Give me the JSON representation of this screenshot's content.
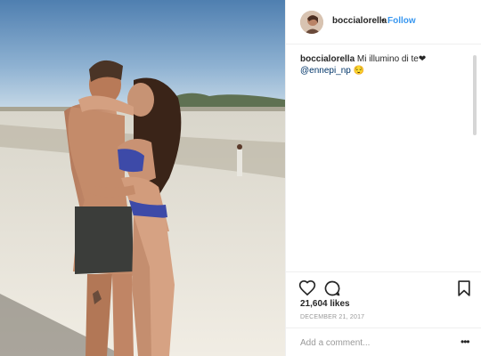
{
  "post": {
    "username": "boccialorella",
    "separator": "•",
    "follow_label": "Follow",
    "caption": {
      "username": "boccialorella",
      "text": "Mi illumino di te❤",
      "mention": "@ennepi_np",
      "emoji": "😌"
    },
    "likes": "21,604 likes",
    "date": "DECEMBER 21, 2017",
    "comment": {
      "placeholder": "Add a comment...",
      "more_label": "•••"
    }
  },
  "icons": {
    "like": "heart-icon",
    "comment": "comment-bubble-icon",
    "save": "bookmark-icon",
    "more": "more-options-icon"
  },
  "colors": {
    "link": "#3897f0",
    "text": "#262626",
    "muted": "#999999"
  }
}
